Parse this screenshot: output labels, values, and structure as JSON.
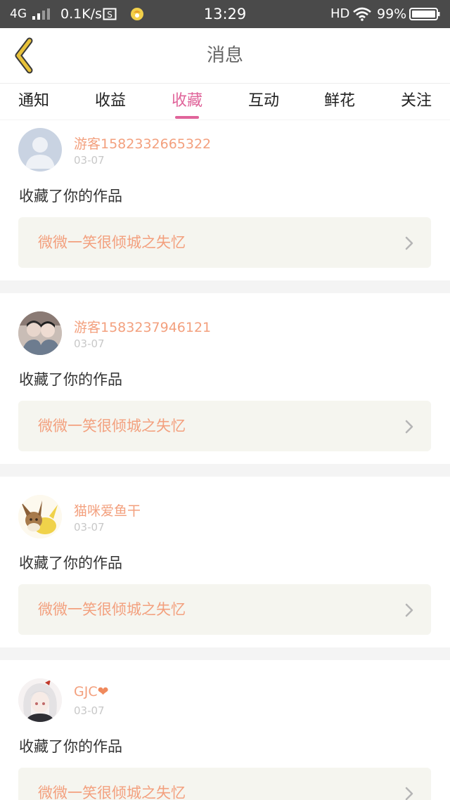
{
  "status_bar": {
    "network": "4G",
    "speed": "0.1K/s",
    "time": "13:29",
    "hd": "HD",
    "battery": "99%"
  },
  "header": {
    "title": "消息"
  },
  "tabs": [
    {
      "label": "通知",
      "active": false
    },
    {
      "label": "收益",
      "active": false
    },
    {
      "label": "收藏",
      "active": true
    },
    {
      "label": "互动",
      "active": false
    },
    {
      "label": "鲜花",
      "active": false
    },
    {
      "label": "关注",
      "active": false
    }
  ],
  "messages": [
    {
      "user": "游客1582332665322",
      "date": "03-07",
      "action": "收藏了你的作品",
      "work": "微微一笑很倾城之失忆",
      "avatar": "default-avatar"
    },
    {
      "user": "游客1583237946121",
      "date": "03-07",
      "action": "收藏了你的作品",
      "work": "微微一笑很倾城之失忆",
      "avatar": "photo-avatar"
    },
    {
      "user": "猫咪爱鱼干",
      "date": "03-07",
      "action": "收藏了你的作品",
      "work": "微微一笑很倾城之失忆",
      "avatar": "cartoon-avatar"
    },
    {
      "user": "GJC",
      "user_suffix": "❤",
      "date": "03-07",
      "action": "收藏了你的作品",
      "work": "微微一笑很倾城之失忆",
      "avatar": "anime-avatar"
    }
  ],
  "colors": {
    "accent": "#e0649a",
    "username": "#f3a07e",
    "back_arrow": "#e8c23a",
    "status_bar": "#4a4a4a"
  }
}
